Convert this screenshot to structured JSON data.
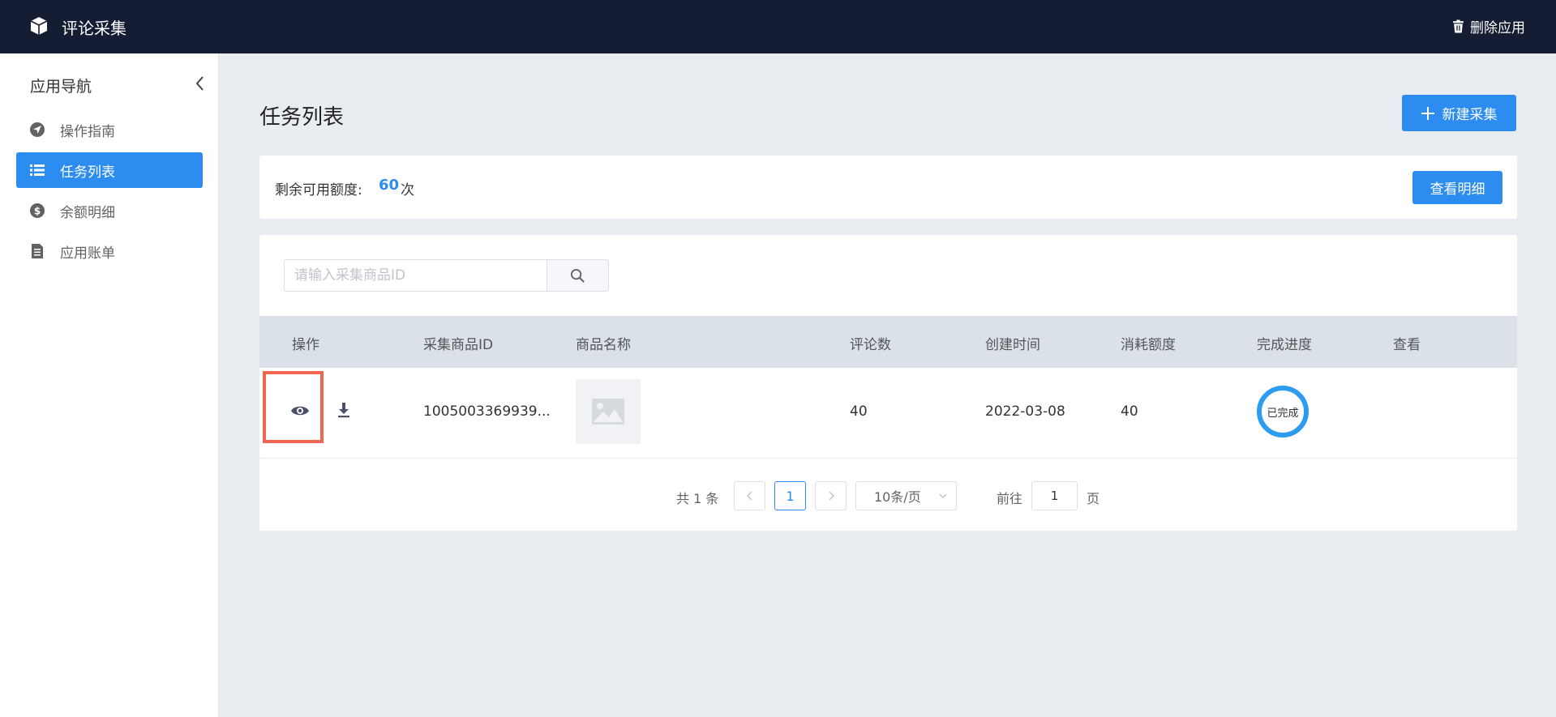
{
  "app": {
    "title": "评论采集",
    "delete_label": "删除应用"
  },
  "sidebar": {
    "title": "应用导航",
    "items": [
      {
        "label": "操作指南",
        "icon": "compass-icon",
        "active": false
      },
      {
        "label": "任务列表",
        "icon": "list-icon",
        "active": true
      },
      {
        "label": "余额明细",
        "icon": "dollar-icon",
        "active": false
      },
      {
        "label": "应用账单",
        "icon": "document-icon",
        "active": false
      }
    ]
  },
  "main": {
    "title": "任务列表",
    "new_button": "新建采集"
  },
  "quota": {
    "label": "剩余可用额度:",
    "value": "60",
    "unit": "次",
    "detail_button": "查看明细"
  },
  "search": {
    "placeholder": "请输入采集商品ID",
    "value": ""
  },
  "table": {
    "columns": [
      "操作",
      "采集商品ID",
      "商品名称",
      "评论数",
      "创建时间",
      "消耗额度",
      "完成进度",
      "查看"
    ],
    "rows": [
      {
        "product_id": "1005003369939...",
        "product_name": "",
        "comments": "40",
        "created": "2022-03-08",
        "cost": "40",
        "progress": "已完成",
        "view": ""
      }
    ]
  },
  "pagination": {
    "total": "共 1 条",
    "current": "1",
    "page_size": "10条/页",
    "goto_label": "前往",
    "goto_value": "1",
    "page_unit": "页"
  },
  "colors": {
    "accent": "#2d8cf0",
    "topbar": "#151d35",
    "highlight": "#f06650"
  }
}
